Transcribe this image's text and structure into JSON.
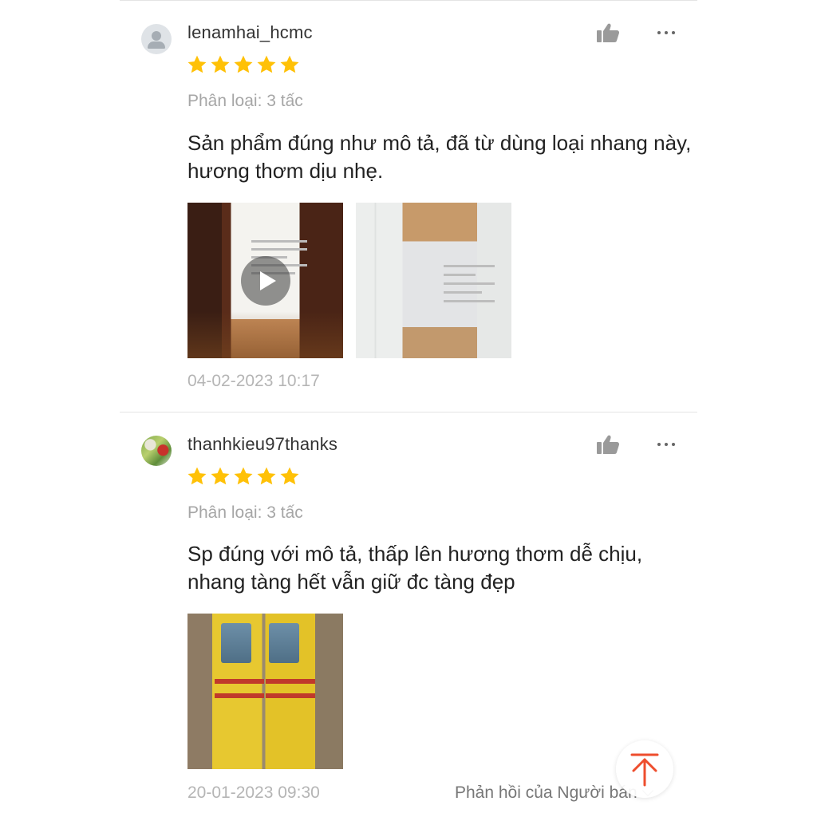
{
  "reviews": [
    {
      "username": "lenamhai_hcmc",
      "rating": 5,
      "variation": "Phân loại: 3 tấc",
      "comment": "Sản phẩm đúng như mô tả, đã từ dùng loại nhang này, hương thơm dịu nhẹ.",
      "media": [
        {
          "type": "video",
          "icon": "play-icon"
        },
        {
          "type": "image"
        }
      ],
      "timestamp": "04-02-2023 10:17"
    },
    {
      "username": "thanhkieu97thanks",
      "rating": 5,
      "variation": "Phân loại: 3 tấc",
      "comment": "Sp đúng với mô tả, thấp lên hương thơm dễ chịu, nhang tàng hết vẫn giữ đc tàng đẹp",
      "media": [
        {
          "type": "image"
        }
      ],
      "timestamp": "20-01-2023 09:30",
      "seller_reply_label": "Phản hồi của Người bán"
    }
  ],
  "icons": {
    "like": "thumbs-up-icon",
    "more": "more-options-icon",
    "star": "star-icon",
    "scroll_top": "arrow-up-to-top-icon"
  },
  "colors": {
    "star": "#FFC107",
    "accent": "#EE4D2D",
    "muted_text": "#A6A6A6",
    "divider": "#E4E4E4"
  }
}
